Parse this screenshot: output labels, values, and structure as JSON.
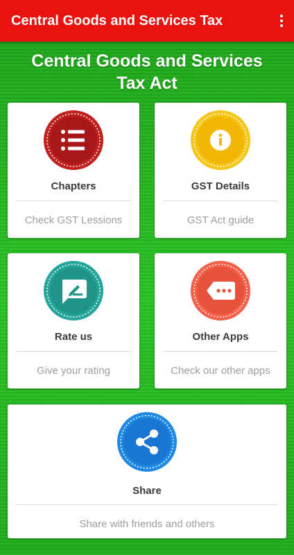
{
  "appbar": {
    "title": "Central Goods and Services Tax",
    "menu_icon": "more-vert-icon"
  },
  "heading": {
    "line1": "Central Goods and Services",
    "line2": "Tax Act"
  },
  "cards": [
    {
      "title": "Chapters",
      "subtitle": "Check GST Lessions",
      "icon": "list-icon",
      "color": "#c0201e"
    },
    {
      "title": "GST Details",
      "subtitle": "GST Act guide",
      "icon": "info-icon",
      "color": "#f5c518"
    },
    {
      "title": "Rate us",
      "subtitle": "Give your rating",
      "icon": "rate-review-icon",
      "color": "#26a69a"
    },
    {
      "title": "Other Apps",
      "subtitle": "Check our other apps",
      "icon": "more-tag-icon",
      "color": "#f4604a"
    },
    {
      "title": "Share",
      "subtitle": "Share with friends and others",
      "icon": "share-icon",
      "color": "#1e88e5"
    }
  ],
  "colors": {
    "appbar": "#e8120f",
    "background": "#22b81e"
  }
}
